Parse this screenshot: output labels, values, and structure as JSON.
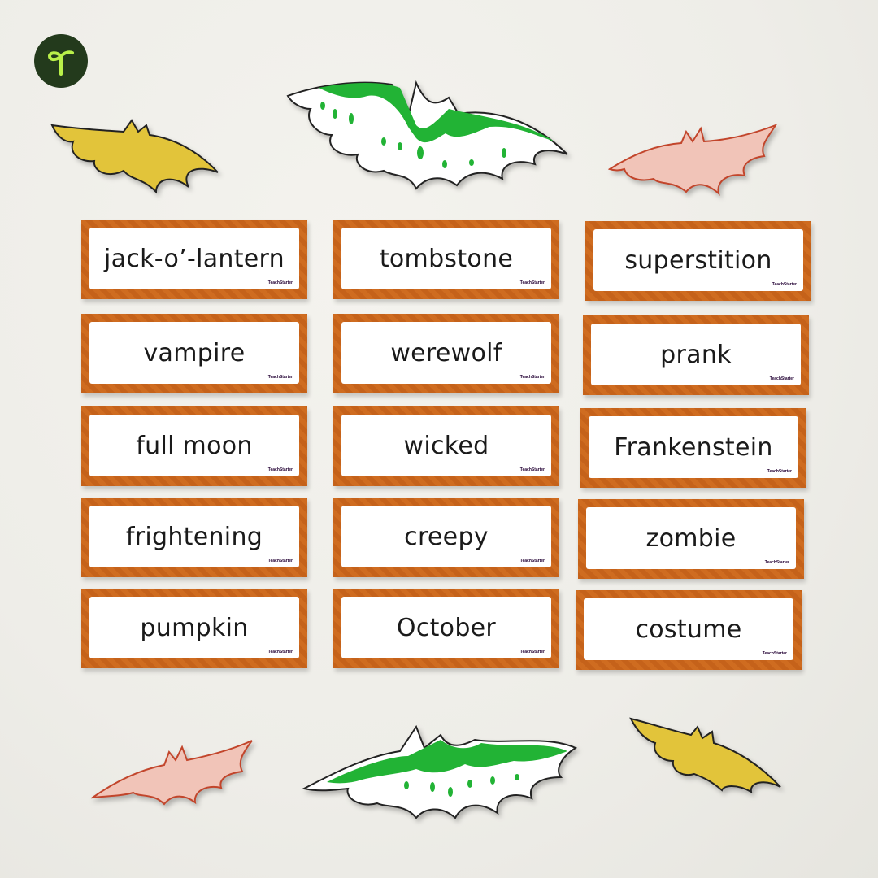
{
  "brand": {
    "logo": "teach-starter-logo",
    "logo_bg": "#233a1c",
    "logo_fg": "#b9f04a",
    "card_brand_text": "TeachStarter"
  },
  "colors": {
    "card_border": "#c9661c",
    "slime_green": "#22b335",
    "yellow_bat": "#e2c43a",
    "pink_bat": "#f1c4b8"
  },
  "cards": {
    "columns": [
      [
        "jack-o’-lantern",
        "vampire",
        "full moon",
        "frightening",
        "pumpkin"
      ],
      [
        "tombstone",
        "werewolf",
        "wicked",
        "creepy",
        "October"
      ],
      [
        "superstition",
        "prank",
        "Frankenstein",
        "zombie",
        "costume"
      ]
    ]
  },
  "bats": [
    {
      "name": "yellow-bat-top-left",
      "color": "yellow"
    },
    {
      "name": "slime-bat-top-center",
      "color": "green-slime"
    },
    {
      "name": "pink-bat-top-right",
      "color": "pink"
    },
    {
      "name": "pink-bat-bottom-left",
      "color": "pink"
    },
    {
      "name": "slime-bat-bottom-center",
      "color": "green-slime"
    },
    {
      "name": "yellow-bat-bottom-right",
      "color": "yellow"
    }
  ]
}
